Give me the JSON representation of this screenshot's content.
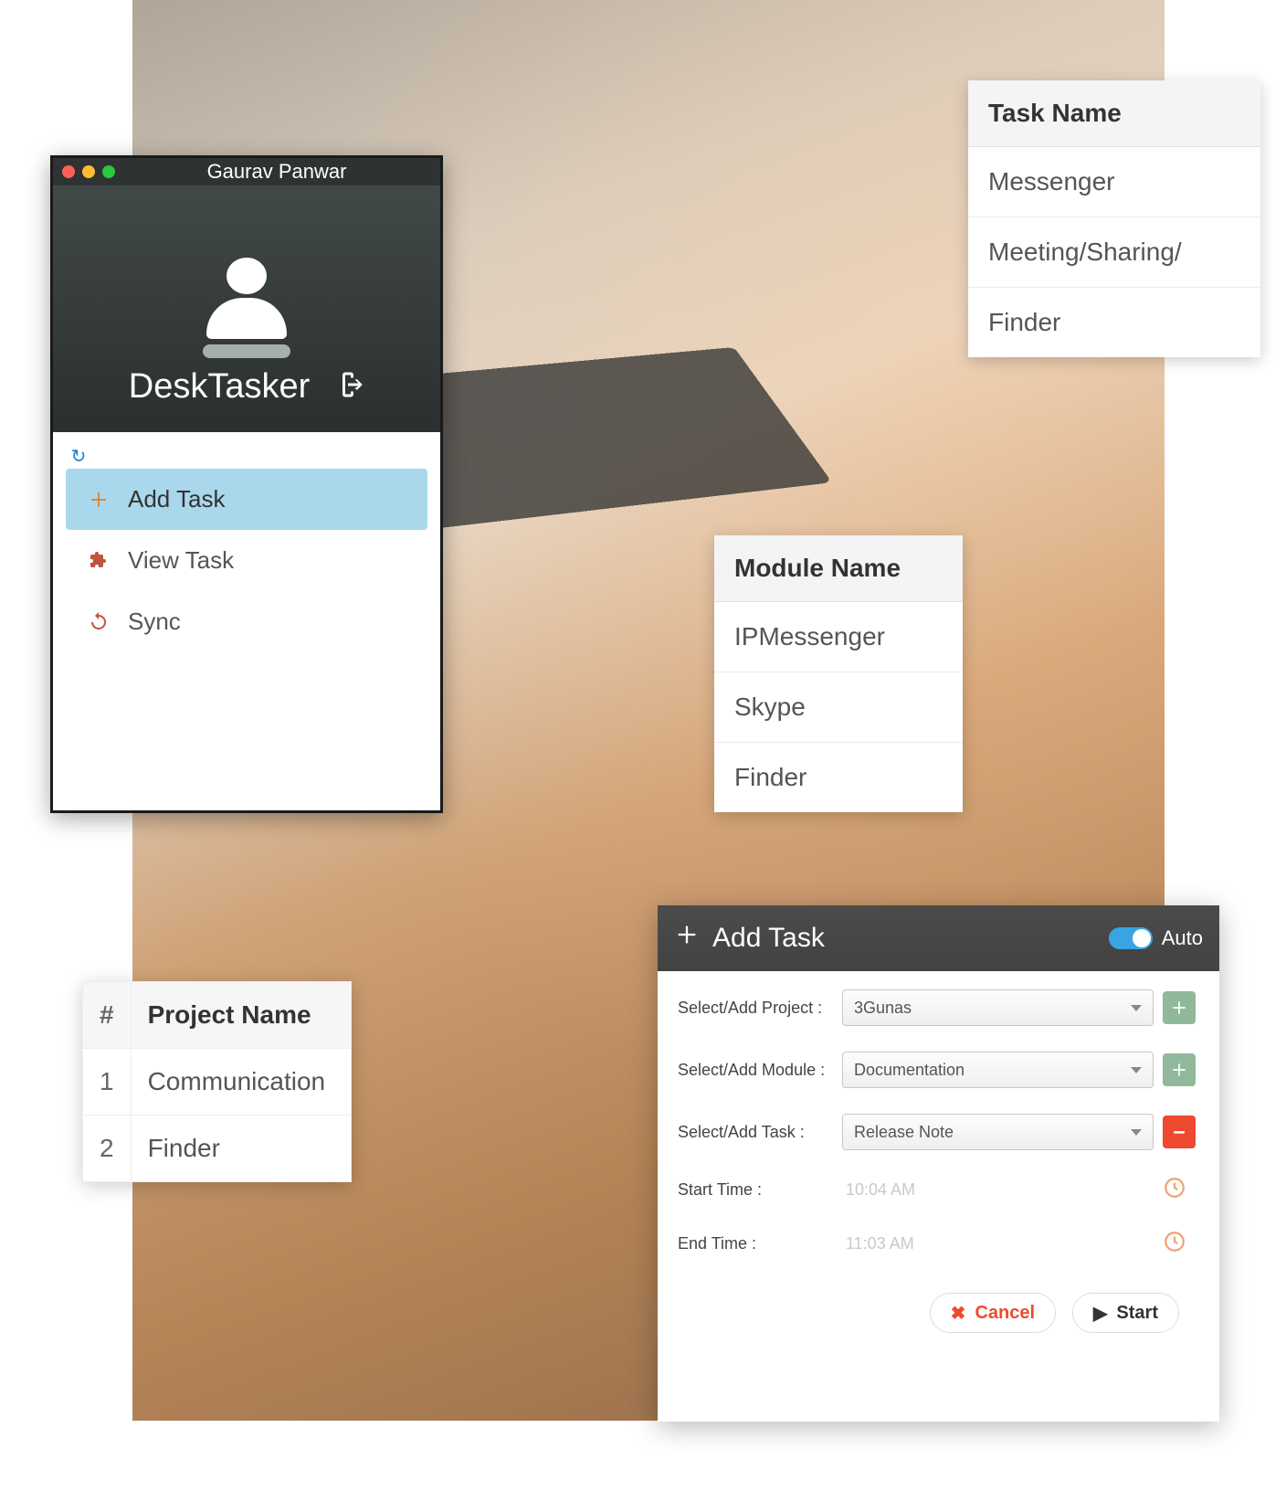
{
  "desktasker": {
    "username": "Gaurav Panwar",
    "title": "DeskTasker",
    "menu": {
      "add_task": "Add Task",
      "view_task": "View Task",
      "sync": "Sync"
    }
  },
  "task_list": {
    "header": "Task Name",
    "items": [
      "Messenger",
      "Meeting/Sharing/",
      "Finder"
    ]
  },
  "module_list": {
    "header": "Module Name",
    "items": [
      "IPMessenger",
      "Skype",
      "Finder"
    ]
  },
  "project_table": {
    "hash_header": "#",
    "name_header": "Project Name",
    "rows": [
      {
        "idx": "1",
        "name": "Communication"
      },
      {
        "idx": "2",
        "name": "Finder"
      }
    ]
  },
  "add_task": {
    "title": "Add Task",
    "auto_label": "Auto",
    "labels": {
      "project": "Select/Add Project :",
      "module": "Select/Add Module :",
      "task": "Select/Add Task :",
      "start_time": "Start Time :",
      "end_time": "End Time :"
    },
    "values": {
      "project": "3Gunas",
      "module": "Documentation",
      "task": "Release Note",
      "start_time": "10:04 AM",
      "end_time": "11:03 AM"
    },
    "buttons": {
      "cancel": "Cancel",
      "start": "Start"
    }
  }
}
